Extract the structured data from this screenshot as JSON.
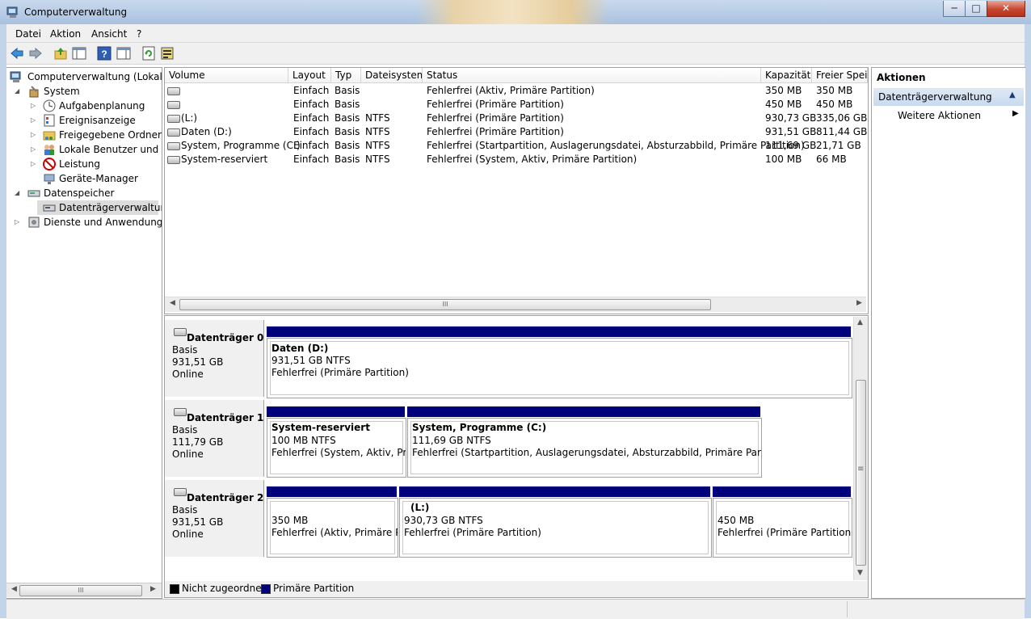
{
  "window": {
    "title": "Computerverwaltung"
  },
  "menu": [
    "Datei",
    "Aktion",
    "Ansicht",
    "?"
  ],
  "toolbar": {
    "icons": [
      "back-arrow-icon",
      "forward-arrow-icon",
      "up-folder-icon",
      "show-hide-tree-icon",
      "help-icon",
      "console-tree-icon",
      "refresh-icon",
      "properties-icon"
    ]
  },
  "tree": {
    "root": "Computerverwaltung (Lokal)",
    "system": "System",
    "aufgabenplanung": "Aufgabenplanung",
    "ereignisanzeige": "Ereignisanzeige",
    "freigegebene_ordner": "Freigegebene Ordner",
    "lokale_benutzer": "Lokale Benutzer und Gr",
    "leistung": "Leistung",
    "geraete_manager": "Geräte-Manager",
    "datenspeicher": "Datenspeicher",
    "datentraegerverwaltung": "Datenträgerverwaltung",
    "dienste": "Dienste und Anwendungen"
  },
  "volumes": {
    "headers": [
      "Volume",
      "Layout",
      "Typ",
      "Dateisystem",
      "Status",
      "Kapazität",
      "Freier Speic"
    ],
    "rows": [
      {
        "volume": "",
        "layout": "Einfach",
        "typ": "Basis",
        "fs": "",
        "status": "Fehlerfrei (Aktiv, Primäre Partition)",
        "cap": "350 MB",
        "free": "350 MB"
      },
      {
        "volume": "",
        "layout": "Einfach",
        "typ": "Basis",
        "fs": "",
        "status": "Fehlerfrei (Primäre Partition)",
        "cap": "450 MB",
        "free": "450 MB"
      },
      {
        "volume": "(L:)",
        "layout": "Einfach",
        "typ": "Basis",
        "fs": "NTFS",
        "status": "Fehlerfrei (Primäre Partition)",
        "cap": "930,73 GB",
        "free": "335,06 GB"
      },
      {
        "volume": "Daten (D:)",
        "layout": "Einfach",
        "typ": "Basis",
        "fs": "NTFS",
        "status": "Fehlerfrei (Primäre Partition)",
        "cap": "931,51 GB",
        "free": "811,44 GB"
      },
      {
        "volume": "System, Programme (C:)",
        "layout": "Einfach",
        "typ": "Basis",
        "fs": "NTFS",
        "status": "Fehlerfrei (Startpartition, Auslagerungsdatei, Absturzabbild, Primäre Partition)",
        "cap": "111,69 GB",
        "free": "21,71 GB"
      },
      {
        "volume": "System-reserviert",
        "layout": "Einfach",
        "typ": "Basis",
        "fs": "NTFS",
        "status": "Fehlerfrei (System, Aktiv, Primäre Partition)",
        "cap": "100 MB",
        "free": "66 MB"
      }
    ]
  },
  "disks": [
    {
      "name": "Datenträger 0",
      "type": "Basis",
      "size": "931,51 GB",
      "state": "Online",
      "partitions": [
        {
          "title": "Daten  (D:)",
          "size": "931,51 GB NTFS",
          "status": "Fehlerfrei (Primäre Partition)"
        }
      ]
    },
    {
      "name": "Datenträger 1",
      "type": "Basis",
      "size": "111,79 GB",
      "state": "Online",
      "partitions": [
        {
          "title": "System-reserviert",
          "size": "100 MB NTFS",
          "status": "Fehlerfrei (System, Aktiv, Prim"
        },
        {
          "title": "System, Programme  (C:)",
          "size": "111,69 GB NTFS",
          "status": "Fehlerfrei (Startpartition, Auslagerungsdatei, Absturzabbild, Primäre Partition)"
        }
      ]
    },
    {
      "name": "Datenträger 2",
      "type": "Basis",
      "size": "931,51 GB",
      "state": "Online",
      "partitions": [
        {
          "title": "",
          "size": "350 MB",
          "status": "Fehlerfrei (Aktiv, Primäre Par"
        },
        {
          "title": "(L:)",
          "size": "930,73 GB NTFS",
          "status": "Fehlerfrei (Primäre Partition)"
        },
        {
          "title": "",
          "size": "450 MB",
          "status": "Fehlerfrei (Primäre Partition)"
        }
      ]
    }
  ],
  "legend": {
    "unallocated": "Nicht zugeordnet",
    "unallocated_color": "#000000",
    "primary": "Primäre Partition",
    "primary_color": "#00007a"
  },
  "actions": {
    "title": "Aktionen",
    "section": "Datenträgerverwaltung",
    "more": "Weitere Aktionen"
  },
  "scroll": {
    "grip": "III",
    "vgrip": "≡"
  }
}
